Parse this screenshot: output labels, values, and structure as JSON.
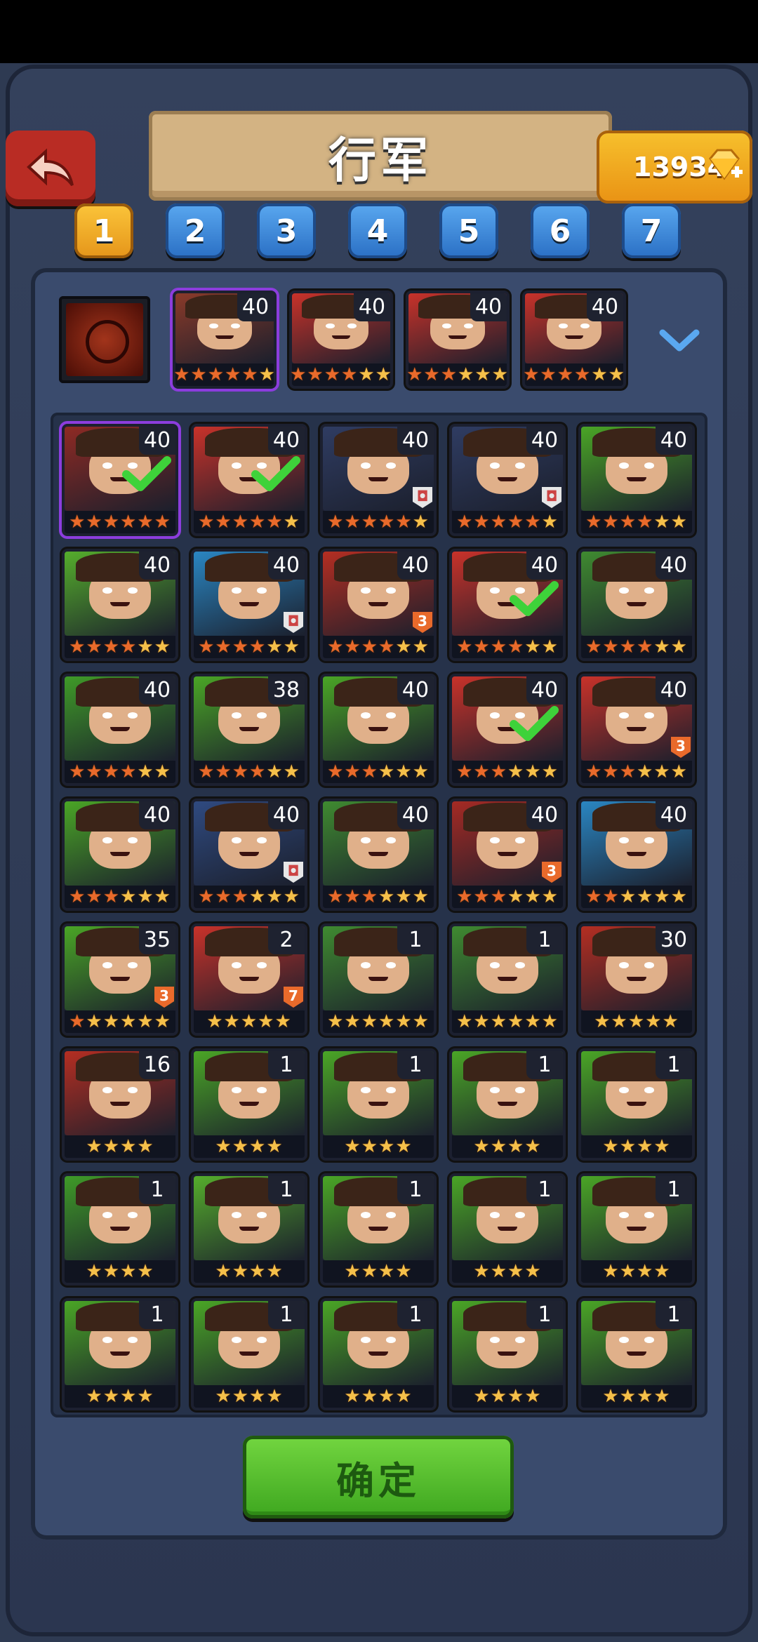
{
  "screen": {
    "title": "行军",
    "back_icon": "back-arrow-icon",
    "gems": "13934",
    "gem_icon": "diamond-plus-icon",
    "confirm_label": "确定",
    "expand_icon": "chevron-down-icon",
    "pet_icon": "pet-slot-icon"
  },
  "tabs": [
    "1",
    "2",
    "3",
    "4",
    "5",
    "6",
    "7"
  ],
  "selected_team": [
    {
      "level": "40",
      "stars": 6,
      "red_stars": 5,
      "color": "#8a3a2a"
    },
    {
      "level": "40",
      "stars": 6,
      "red_stars": 4,
      "color": "#c8322a"
    },
    {
      "level": "40",
      "stars": 6,
      "red_stars": 3,
      "color": "#c8322a"
    },
    {
      "level": "40",
      "stars": 6,
      "red_stars": 4,
      "color": "#c8322a"
    }
  ],
  "roster": [
    {
      "level": "40",
      "stars": 6,
      "red_stars": 6,
      "bg": "#8e2a24",
      "checked": true,
      "selected": true,
      "badge": ""
    },
    {
      "level": "40",
      "stars": 6,
      "red_stars": 5,
      "bg": "#c8322a",
      "checked": true,
      "selected": false,
      "badge": ""
    },
    {
      "level": "40",
      "stars": 6,
      "red_stars": 5,
      "bg": "#2f3c62",
      "checked": false,
      "selected": false,
      "badge": "shield"
    },
    {
      "level": "40",
      "stars": 6,
      "red_stars": 5,
      "bg": "#2f3c62",
      "checked": false,
      "selected": false,
      "badge": "shield"
    },
    {
      "level": "40",
      "stars": 6,
      "red_stars": 4,
      "bg": "#4aa526",
      "checked": false,
      "selected": false,
      "badge": ""
    },
    {
      "level": "40",
      "stars": 6,
      "red_stars": 4,
      "bg": "#55ad2c",
      "checked": false,
      "selected": false,
      "badge": ""
    },
    {
      "level": "40",
      "stars": 6,
      "red_stars": 4,
      "bg": "#2a86c2",
      "checked": false,
      "selected": false,
      "badge": "shield"
    },
    {
      "level": "40",
      "stars": 6,
      "red_stars": 4,
      "bg": "#b42e22",
      "checked": false,
      "selected": false,
      "badge": "3"
    },
    {
      "level": "40",
      "stars": 6,
      "red_stars": 4,
      "bg": "#c8322a",
      "checked": true,
      "selected": false,
      "badge": ""
    },
    {
      "level": "40",
      "stars": 6,
      "red_stars": 4,
      "bg": "#3f8a30",
      "checked": false,
      "selected": false,
      "badge": ""
    },
    {
      "level": "40",
      "stars": 6,
      "red_stars": 4,
      "bg": "#3f9a28",
      "checked": false,
      "selected": false,
      "badge": ""
    },
    {
      "level": "38",
      "stars": 6,
      "red_stars": 4,
      "bg": "#4aa526",
      "checked": false,
      "selected": false,
      "badge": ""
    },
    {
      "level": "40",
      "stars": 6,
      "red_stars": 3,
      "bg": "#4aa526",
      "checked": false,
      "selected": false,
      "badge": ""
    },
    {
      "level": "40",
      "stars": 6,
      "red_stars": 3,
      "bg": "#c8322a",
      "checked": true,
      "selected": false,
      "badge": ""
    },
    {
      "level": "40",
      "stars": 6,
      "red_stars": 3,
      "bg": "#c8322a",
      "checked": false,
      "selected": false,
      "badge": "3"
    },
    {
      "level": "40",
      "stars": 6,
      "red_stars": 3,
      "bg": "#4aa526",
      "checked": false,
      "selected": false,
      "badge": ""
    },
    {
      "level": "40",
      "stars": 6,
      "red_stars": 3,
      "bg": "#2f4a80",
      "checked": false,
      "selected": false,
      "badge": "shield"
    },
    {
      "level": "40",
      "stars": 6,
      "red_stars": 3,
      "bg": "#3f8a30",
      "checked": false,
      "selected": false,
      "badge": ""
    },
    {
      "level": "40",
      "stars": 6,
      "red_stars": 3,
      "bg": "#a52a24",
      "checked": false,
      "selected": false,
      "badge": "3"
    },
    {
      "level": "40",
      "stars": 6,
      "red_stars": 2,
      "bg": "#2a86c2",
      "checked": false,
      "selected": false,
      "badge": ""
    },
    {
      "level": "35",
      "stars": 6,
      "red_stars": 1,
      "bg": "#4aa526",
      "checked": false,
      "selected": false,
      "badge": "3"
    },
    {
      "level": "2",
      "stars": 5,
      "red_stars": 0,
      "bg": "#c8322a",
      "checked": false,
      "selected": false,
      "badge": "7"
    },
    {
      "level": "1",
      "stars": 6,
      "red_stars": 0,
      "bg": "#3f8a30",
      "checked": false,
      "selected": false,
      "badge": ""
    },
    {
      "level": "1",
      "stars": 6,
      "red_stars": 0,
      "bg": "#3f8a30",
      "checked": false,
      "selected": false,
      "badge": ""
    },
    {
      "level": "30",
      "stars": 5,
      "red_stars": 0,
      "bg": "#b42e22",
      "checked": false,
      "selected": false,
      "badge": ""
    },
    {
      "level": "16",
      "stars": 4,
      "red_stars": 0,
      "bg": "#b42e22",
      "checked": false,
      "selected": false,
      "badge": ""
    },
    {
      "level": "1",
      "stars": 4,
      "red_stars": 0,
      "bg": "#4aa526",
      "checked": false,
      "selected": false,
      "badge": ""
    },
    {
      "level": "1",
      "stars": 4,
      "red_stars": 0,
      "bg": "#4aa526",
      "checked": false,
      "selected": false,
      "badge": ""
    },
    {
      "level": "1",
      "stars": 4,
      "red_stars": 0,
      "bg": "#4aa526",
      "checked": false,
      "selected": false,
      "badge": ""
    },
    {
      "level": "1",
      "stars": 4,
      "red_stars": 0,
      "bg": "#4aa526",
      "checked": false,
      "selected": false,
      "badge": ""
    },
    {
      "level": "1",
      "stars": 4,
      "red_stars": 0,
      "bg": "#3f9a28",
      "checked": false,
      "selected": false,
      "badge": ""
    },
    {
      "level": "1",
      "stars": 4,
      "red_stars": 0,
      "bg": "#55ad2c",
      "checked": false,
      "selected": false,
      "badge": ""
    },
    {
      "level": "1",
      "stars": 4,
      "red_stars": 0,
      "bg": "#4aa526",
      "checked": false,
      "selected": false,
      "badge": ""
    },
    {
      "level": "1",
      "stars": 4,
      "red_stars": 0,
      "bg": "#4aa526",
      "checked": false,
      "selected": false,
      "badge": ""
    },
    {
      "level": "1",
      "stars": 4,
      "red_stars": 0,
      "bg": "#4aa526",
      "checked": false,
      "selected": false,
      "badge": ""
    },
    {
      "level": "1",
      "stars": 4,
      "red_stars": 0,
      "bg": "#4aa526",
      "checked": false,
      "selected": false,
      "badge": ""
    },
    {
      "level": "1",
      "stars": 4,
      "red_stars": 0,
      "bg": "#4aa526",
      "checked": false,
      "selected": false,
      "badge": ""
    },
    {
      "level": "1",
      "stars": 4,
      "red_stars": 0,
      "bg": "#4aa526",
      "checked": false,
      "selected": false,
      "badge": ""
    },
    {
      "level": "1",
      "stars": 4,
      "red_stars": 0,
      "bg": "#4aa526",
      "checked": false,
      "selected": false,
      "badge": ""
    },
    {
      "level": "1",
      "stars": 4,
      "red_stars": 0,
      "bg": "#4aa526",
      "checked": false,
      "selected": false,
      "badge": ""
    }
  ]
}
